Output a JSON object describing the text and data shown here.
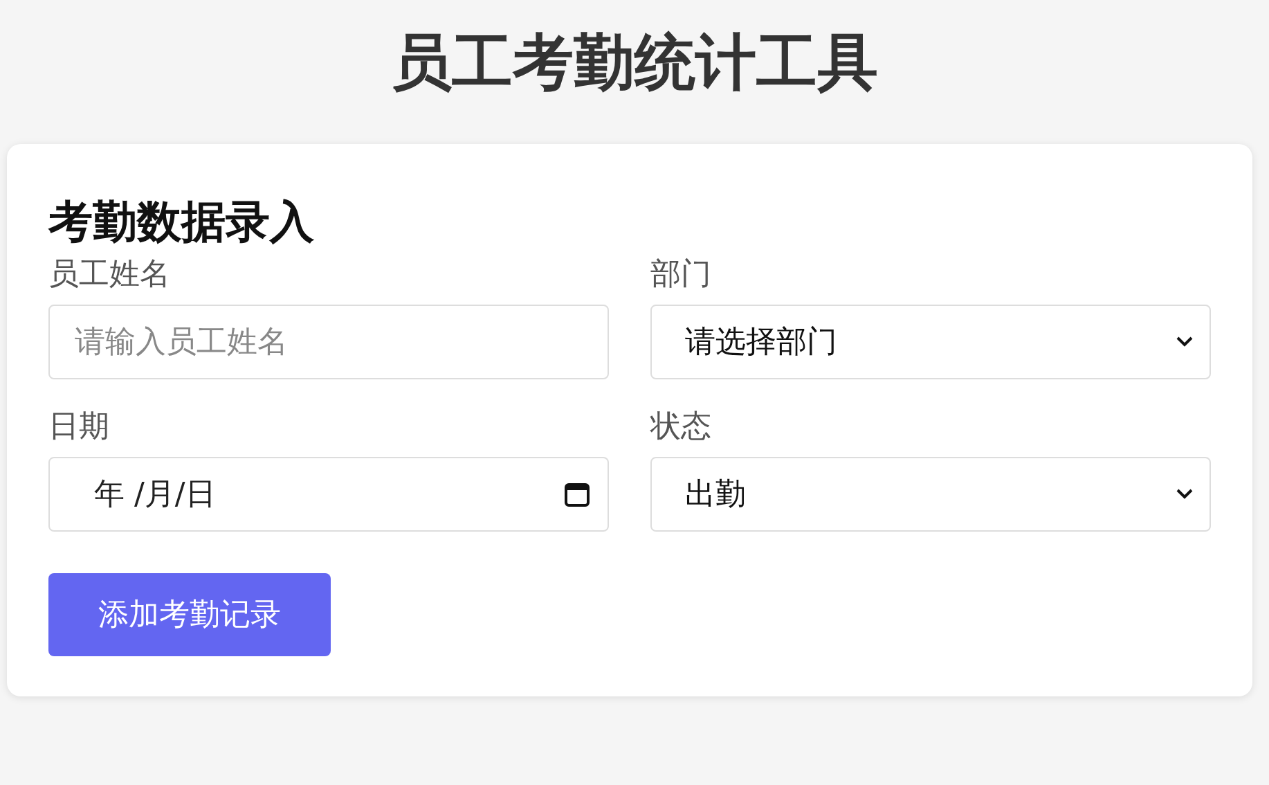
{
  "page_title": "员工考勤统计工具",
  "form": {
    "title": "考勤数据录入",
    "fields": [
      {
        "kind": "text",
        "label": "员工姓名",
        "placeholder": "请输入员工姓名"
      },
      {
        "kind": "select",
        "label": "部门",
        "value": "请选择部门"
      },
      {
        "kind": "date",
        "label": "日期",
        "placeholder": "年 /月/日"
      },
      {
        "kind": "select",
        "label": "状态",
        "value": "出勤"
      }
    ],
    "submit": "添加考勤记录"
  }
}
